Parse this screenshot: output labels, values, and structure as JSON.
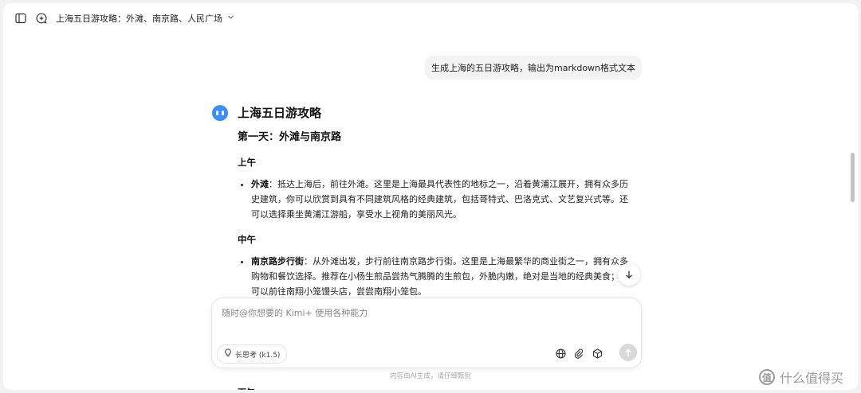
{
  "topbar": {
    "sidebar_icon": "sidebar-toggle-icon",
    "new_chat_icon": "new-chat-icon",
    "title": "上海五日游攻略：外滩、南京路、人民广场"
  },
  "user_message": "生成上海的五日游攻略，输出为markdown格式文本",
  "answer": {
    "title": "上海五日游攻略",
    "day1_heading": "第一天：外滩与南京路",
    "morning_heading": "上午",
    "morning_items": [
      {
        "bold": "外滩",
        "text": "：抵达上海后，前往外滩。这里是上海最具代表性的地标之一，沿着黄浦江展开，拥有众多历史建筑，你可以欣赏到具有不同建筑风格的经典建筑，包括哥特式、巴洛克式、文艺复兴式等。还可以选择乘坐黄浦江游船，享受水上视角的美丽风光。"
      }
    ],
    "noon_heading": "中午",
    "noon_items": [
      {
        "bold": "南京路步行街",
        "text": "：从外滩出发，步行前往南京路步行街。这里是上海最繁华的商业街之一，拥有众多购物和餐饮选择。推荐在小杨生煎品尝热气腾腾的生煎包，外脆内嫩，绝对是当地的经典美食；也可以前往南翔小笼馒头店，尝尝南翔小笼包。"
      }
    ]
  },
  "composer": {
    "placeholder": "随时@你想要的 Kimi+ 使用各种能力",
    "mode_label": "长思考 (k1.5)",
    "icons": [
      "globe-icon",
      "paperclip-icon",
      "cube-icon",
      "send-arrow-icon"
    ]
  },
  "disclaimer": "内容由AI生成，请仔细甄别",
  "watermark": {
    "logo_text": "值",
    "text": "什么值得买"
  },
  "colors": {
    "accent": "#3b8ef5",
    "bubble": "#f3f3f3",
    "send_disabled": "#d9d9d9"
  }
}
